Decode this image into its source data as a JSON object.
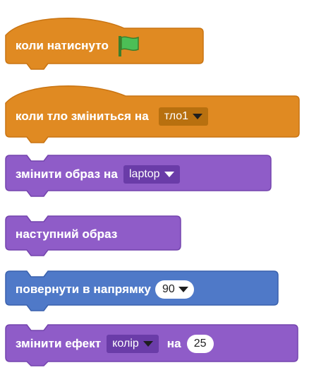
{
  "blocks": [
    {
      "id": "when-flag",
      "label": "коли натиснуто",
      "flag_icon": "green-flag-icon",
      "color": "#e08a22"
    },
    {
      "id": "when-backdrop",
      "label": "коли тло зміниться на",
      "dropdown": "тло1",
      "color": "#e08a22"
    },
    {
      "id": "switch-costume",
      "label": "змінити образ на",
      "dropdown": "laptop",
      "color": "#8f5cc8"
    },
    {
      "id": "next-costume",
      "label": "наступний образ",
      "color": "#8f5cc8"
    },
    {
      "id": "point-direction",
      "label": "повернути в напрямку",
      "value": "90",
      "color": "#4f79c8"
    },
    {
      "id": "change-effect",
      "label": "змінити ефект",
      "dropdown": "колір",
      "label2": "на",
      "value": "25",
      "color": "#8f5cc8"
    }
  ]
}
